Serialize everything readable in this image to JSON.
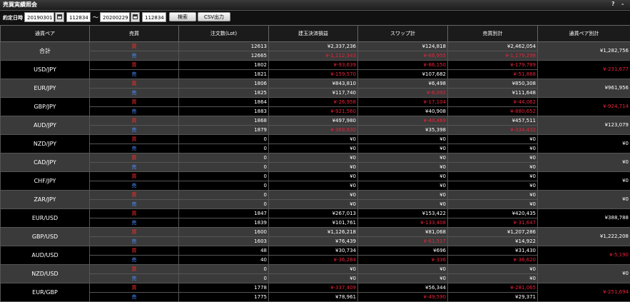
{
  "window": {
    "title": "売買実績照会",
    "help_icon": "?",
    "close_icon": "-"
  },
  "filter": {
    "label": "約定日時",
    "from_date": "20190301",
    "from_time": "112834",
    "separator": "～",
    "to_date": "20200229",
    "to_time": "112834",
    "search_label": "検索",
    "csv_label": "CSV出力"
  },
  "headers": [
    "通貨ペア",
    "売買",
    "注文数(Lot)",
    "建玉決済損益",
    "スワップ計",
    "売買別計",
    "通貨ペア別計"
  ],
  "side_labels": {
    "buy": "買",
    "sell": "売"
  },
  "rows": [
    {
      "pair": "合計",
      "total": "¥1,282,756",
      "total_neg": false,
      "buy": {
        "lots": "12613",
        "pl": "¥2,337,236",
        "pl_neg": false,
        "swap": "¥124,818",
        "swap_neg": false,
        "side_total": "¥2,462,054",
        "side_total_neg": false
      },
      "sell": {
        "lots": "12665",
        "pl": "¥-1,112,343",
        "pl_neg": true,
        "swap": "¥-66,955",
        "swap_neg": true,
        "side_total": "¥-1,179,298",
        "side_total_neg": true
      }
    },
    {
      "pair": "USD/JPY",
      "total": "¥-231,677",
      "total_neg": true,
      "buy": {
        "lots": "1802",
        "pl": "¥-93,639",
        "pl_neg": true,
        "swap": "¥-86,150",
        "swap_neg": true,
        "side_total": "¥-179,789",
        "side_total_neg": true
      },
      "sell": {
        "lots": "1821",
        "pl": "¥-159,570",
        "pl_neg": true,
        "swap": "¥107,682",
        "swap_neg": false,
        "side_total": "¥-51,888",
        "side_total_neg": true
      }
    },
    {
      "pair": "EUR/JPY",
      "total": "¥961,956",
      "total_neg": false,
      "buy": {
        "lots": "1806",
        "pl": "¥843,810",
        "pl_neg": false,
        "swap": "¥6,498",
        "swap_neg": false,
        "side_total": "¥850,308",
        "side_total_neg": false
      },
      "sell": {
        "lots": "1825",
        "pl": "¥117,740",
        "pl_neg": false,
        "swap": "¥-6,092",
        "swap_neg": true,
        "side_total": "¥111,648",
        "side_total_neg": false
      }
    },
    {
      "pair": "GBP/JPY",
      "total": "¥-924,714",
      "total_neg": true,
      "buy": {
        "lots": "1864",
        "pl": "¥-26,958",
        "pl_neg": true,
        "swap": "¥-17,104",
        "swap_neg": true,
        "side_total": "¥-44,062",
        "side_total_neg": true
      },
      "sell": {
        "lots": "1883",
        "pl": "¥-921,560",
        "pl_neg": true,
        "swap": "¥40,908",
        "swap_neg": false,
        "side_total": "¥-880,652",
        "side_total_neg": true
      }
    },
    {
      "pair": "AUD/JPY",
      "total": "¥123,079",
      "total_neg": false,
      "buy": {
        "lots": "1868",
        "pl": "¥497,980",
        "pl_neg": false,
        "swap": "¥-40,469",
        "swap_neg": true,
        "side_total": "¥457,511",
        "side_total_neg": false
      },
      "sell": {
        "lots": "1879",
        "pl": "¥-369,830",
        "pl_neg": true,
        "swap": "¥35,398",
        "swap_neg": false,
        "side_total": "¥-334,432",
        "side_total_neg": true
      }
    },
    {
      "pair": "NZD/JPY",
      "total": "¥0",
      "total_neg": false,
      "buy": {
        "lots": "0",
        "pl": "¥0",
        "pl_neg": false,
        "swap": "¥0",
        "swap_neg": false,
        "side_total": "¥0",
        "side_total_neg": false
      },
      "sell": {
        "lots": "0",
        "pl": "¥0",
        "pl_neg": false,
        "swap": "¥0",
        "swap_neg": false,
        "side_total": "¥0",
        "side_total_neg": false
      }
    },
    {
      "pair": "CAD/JPY",
      "total": "¥0",
      "total_neg": false,
      "buy": {
        "lots": "0",
        "pl": "¥0",
        "pl_neg": false,
        "swap": "¥0",
        "swap_neg": false,
        "side_total": "¥0",
        "side_total_neg": false
      },
      "sell": {
        "lots": "0",
        "pl": "¥0",
        "pl_neg": false,
        "swap": "¥0",
        "swap_neg": false,
        "side_total": "¥0",
        "side_total_neg": false
      }
    },
    {
      "pair": "CHF/JPY",
      "total": "¥0",
      "total_neg": false,
      "buy": {
        "lots": "0",
        "pl": "¥0",
        "pl_neg": false,
        "swap": "¥0",
        "swap_neg": false,
        "side_total": "¥0",
        "side_total_neg": false
      },
      "sell": {
        "lots": "0",
        "pl": "¥0",
        "pl_neg": false,
        "swap": "¥0",
        "swap_neg": false,
        "side_total": "¥0",
        "side_total_neg": false
      }
    },
    {
      "pair": "ZAR/JPY",
      "total": "¥0",
      "total_neg": false,
      "buy": {
        "lots": "0",
        "pl": "¥0",
        "pl_neg": false,
        "swap": "¥0",
        "swap_neg": false,
        "side_total": "¥0",
        "side_total_neg": false
      },
      "sell": {
        "lots": "0",
        "pl": "¥0",
        "pl_neg": false,
        "swap": "¥0",
        "swap_neg": false,
        "side_total": "¥0",
        "side_total_neg": false
      }
    },
    {
      "pair": "EUR/USD",
      "total": "¥388,788",
      "total_neg": false,
      "buy": {
        "lots": "1847",
        "pl": "¥267,013",
        "pl_neg": false,
        "swap": "¥153,422",
        "swap_neg": false,
        "side_total": "¥420,435",
        "side_total_neg": false
      },
      "sell": {
        "lots": "1839",
        "pl": "¥101,761",
        "pl_neg": false,
        "swap": "¥-133,408",
        "swap_neg": true,
        "side_total": "¥-31,647",
        "side_total_neg": true
      }
    },
    {
      "pair": "GBP/USD",
      "total": "¥1,222,208",
      "total_neg": false,
      "buy": {
        "lots": "1600",
        "pl": "¥1,126,218",
        "pl_neg": false,
        "swap": "¥81,068",
        "swap_neg": false,
        "side_total": "¥1,207,286",
        "side_total_neg": false
      },
      "sell": {
        "lots": "1603",
        "pl": "¥76,439",
        "pl_neg": false,
        "swap": "¥-61,517",
        "swap_neg": true,
        "side_total": "¥14,922",
        "side_total_neg": false
      }
    },
    {
      "pair": "AUD/USD",
      "total": "¥-5,190",
      "total_neg": true,
      "buy": {
        "lots": "48",
        "pl": "¥30,734",
        "pl_neg": false,
        "swap": "¥696",
        "swap_neg": false,
        "side_total": "¥31,430",
        "side_total_neg": false
      },
      "sell": {
        "lots": "40",
        "pl": "¥-36,284",
        "pl_neg": true,
        "swap": "¥-336",
        "swap_neg": true,
        "side_total": "¥-36,620",
        "side_total_neg": true
      }
    },
    {
      "pair": "NZD/USD",
      "total": "¥0",
      "total_neg": false,
      "buy": {
        "lots": "0",
        "pl": "¥0",
        "pl_neg": false,
        "swap": "¥0",
        "swap_neg": false,
        "side_total": "¥0",
        "side_total_neg": false
      },
      "sell": {
        "lots": "0",
        "pl": "¥0",
        "pl_neg": false,
        "swap": "¥0",
        "swap_neg": false,
        "side_total": "¥0",
        "side_total_neg": false
      }
    },
    {
      "pair": "EUR/GBP",
      "total": "¥-251,694",
      "total_neg": true,
      "buy": {
        "lots": "1778",
        "pl": "¥-337,409",
        "pl_neg": true,
        "swap": "¥56,344",
        "swap_neg": false,
        "side_total": "¥-281,065",
        "side_total_neg": true
      },
      "sell": {
        "lots": "1775",
        "pl": "¥78,961",
        "pl_neg": false,
        "swap": "¥-49,590",
        "swap_neg": true,
        "side_total": "¥29,371",
        "side_total_neg": false
      }
    }
  ]
}
